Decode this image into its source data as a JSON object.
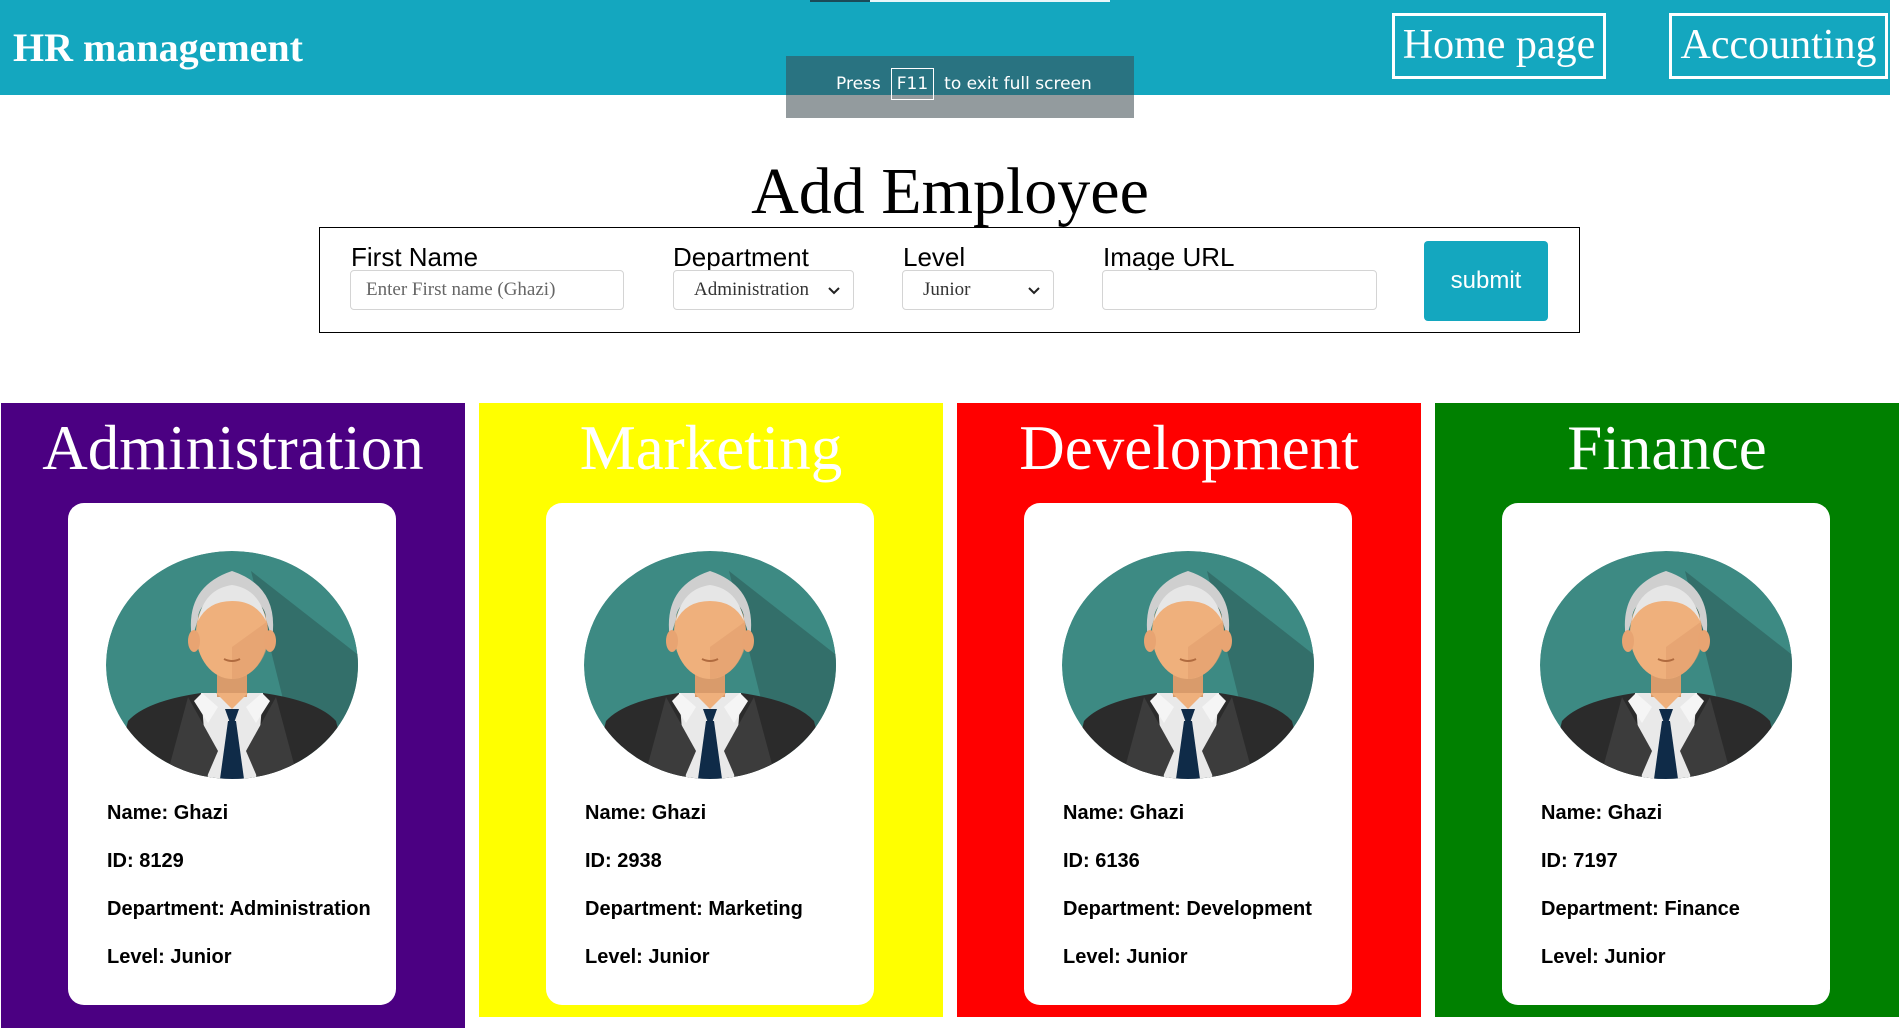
{
  "header": {
    "brand": "HR management",
    "nav": [
      {
        "label": "Home page"
      },
      {
        "label": "Accounting"
      }
    ],
    "color": "#14a7bf"
  },
  "fullscreen_banner": {
    "prefix": "Press",
    "key": "F11",
    "suffix": "to exit full screen"
  },
  "form": {
    "title": "Add Employee",
    "first_name": {
      "label": "First Name",
      "placeholder": "Enter First name (Ghazi)",
      "value": ""
    },
    "department": {
      "label": "Department",
      "selected": "Administration"
    },
    "level": {
      "label": "Level",
      "selected": "Junior"
    },
    "image_url": {
      "label": "Image URL",
      "value": ""
    },
    "submit_label": "submit"
  },
  "departments": [
    {
      "title": "Administration",
      "color": "#4b0082",
      "employee": {
        "name": "Name: Ghazi",
        "id": "ID: 8129",
        "department": "Department: Administration",
        "level": "Level: Junior"
      }
    },
    {
      "title": "Marketing",
      "color": "#ffff00",
      "employee": {
        "name": "Name: Ghazi",
        "id": "ID: 2938",
        "department": "Department: Marketing",
        "level": "Level: Junior"
      }
    },
    {
      "title": "Development",
      "color": "#ff0000",
      "employee": {
        "name": "Name: Ghazi",
        "id": "ID: 6136",
        "department": "Department: Development",
        "level": "Level: Junior"
      }
    },
    {
      "title": "Finance",
      "color": "#008000",
      "employee": {
        "name": "Name: Ghazi",
        "id": "ID: 7197",
        "department": "Department: Finance",
        "level": "Level: Junior"
      }
    }
  ],
  "icons": [
    "chevron-down-icon",
    "employee-avatar-icon"
  ]
}
